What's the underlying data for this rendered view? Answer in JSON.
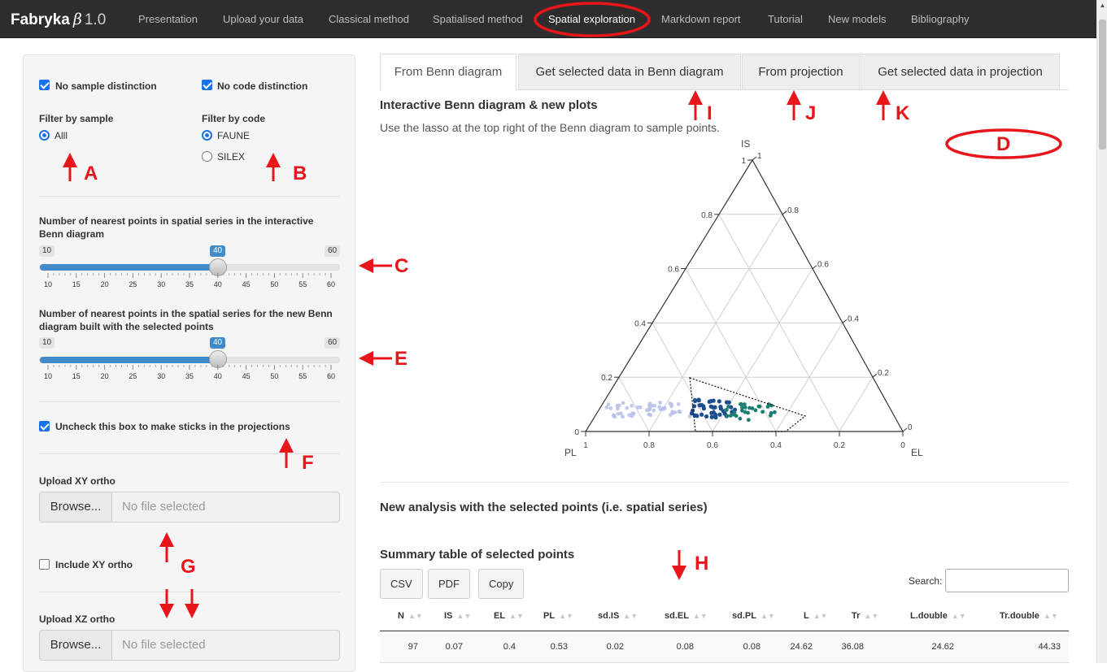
{
  "app": {
    "brand": "Fabryka",
    "beta_symbol": "β",
    "version": "1.0"
  },
  "nav": [
    "Presentation",
    "Upload your data",
    "Classical method",
    "Spatialised method",
    "Spatial exploration",
    "Markdown report",
    "Tutorial",
    "New models",
    "Bibliography"
  ],
  "nav_active": "Spatial exploration",
  "sidebar": {
    "no_sample_distinction": "No sample distinction",
    "no_code_distinction": "No code distinction",
    "filter_sample_label": "Filter by sample",
    "filter_sample_options": [
      "Alll"
    ],
    "filter_code_label": "Filter by code",
    "filter_code_options": [
      "FAUNE",
      "SILEX"
    ],
    "slider1": {
      "title": "Number of nearest points in spatial series in the interactive Benn diagram",
      "min": "10",
      "max": "60",
      "value": "40"
    },
    "slider2": {
      "title": "Number of nearest points in the spatial series for the new Benn diagram built with the selected points",
      "min": "10",
      "max": "60",
      "value": "40"
    },
    "slider_ticks": [
      "10",
      "15",
      "20",
      "25",
      "30",
      "35",
      "40",
      "45",
      "50",
      "55",
      "60"
    ],
    "sticks_checkbox": "Uncheck this box to make sticks in the projections",
    "upload_xy_label": "Upload XY ortho",
    "browse_label": "Browse...",
    "no_file": "No file selected",
    "include_xy_label": "Include XY ortho",
    "upload_xz_label": "Upload XZ ortho"
  },
  "tabs": [
    "From Benn diagram",
    "Get selected data in Benn diagram",
    "From projection",
    "Get selected data in projection"
  ],
  "main": {
    "heading": "Interactive Benn diagram & new plots",
    "instruction": "Use the lasso at the top right of the Benn diagram to sample points.",
    "new_analysis": "New analysis with the selected points (i.e. spatial series)",
    "summary_title": "Summary table of selected points",
    "buttons": [
      "CSV",
      "PDF",
      "Copy"
    ],
    "search_label": "Search:"
  },
  "benn": {
    "axis_is": "IS",
    "axis_pl": "PL",
    "axis_el": "EL",
    "left_ticks": [
      "0",
      "0.2",
      "0.4",
      "0.6",
      "0.8",
      "1"
    ],
    "right_ticks": [
      "0",
      "0.2",
      "0.4",
      "0.6",
      "0.8",
      "1"
    ],
    "bottom_ticks": [
      "1",
      "0.8",
      "0.6",
      "0.4",
      "0.2",
      "0"
    ],
    "colors": {
      "light": "#b9bfe6",
      "dark": "#1d4c8f",
      "teal": "#1a7f72"
    }
  },
  "table": {
    "columns": [
      "N",
      "IS",
      "EL",
      "PL",
      "sd.IS",
      "sd.EL",
      "sd.PL",
      "L",
      "Tr",
      "L.double",
      "Tr.double"
    ],
    "rows": [
      [
        "97",
        "0.07",
        "0.4",
        "0.53",
        "0.02",
        "0.08",
        "0.08",
        "24.62",
        "36.08",
        "24.62",
        "44.33"
      ]
    ]
  },
  "annotations": [
    "A",
    "B",
    "C",
    "D",
    "E",
    "F",
    "G",
    "H",
    "I",
    "J",
    "K"
  ]
}
